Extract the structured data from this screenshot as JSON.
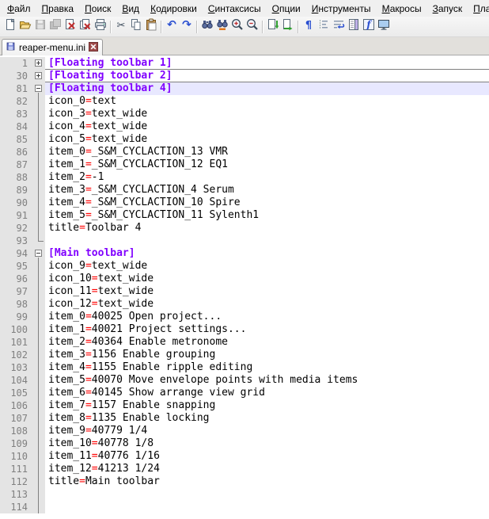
{
  "menu": {
    "items": [
      {
        "label": "Файл",
        "underline": 0
      },
      {
        "label": "Правка",
        "underline": 0
      },
      {
        "label": "Поиск",
        "underline": 0
      },
      {
        "label": "Вид",
        "underline": 0
      },
      {
        "label": "Кодировки",
        "underline": 0
      },
      {
        "label": "Синтаксисы",
        "underline": 0
      },
      {
        "label": "Опции",
        "underline": 0
      },
      {
        "label": "Инструменты",
        "underline": 0
      },
      {
        "label": "Макросы",
        "underline": 0
      },
      {
        "label": "Запуск",
        "underline": 0
      },
      {
        "label": "Пла",
        "underline": 0
      }
    ]
  },
  "toolbar": {
    "buttons": [
      {
        "icon": "new-file"
      },
      {
        "icon": "open-folder"
      },
      {
        "icon": "save",
        "disabled": true
      },
      {
        "icon": "save-all",
        "disabled": true
      },
      {
        "icon": "close"
      },
      {
        "icon": "close-all"
      },
      {
        "icon": "print"
      },
      {
        "icon": "separator"
      },
      {
        "icon": "cut"
      },
      {
        "icon": "copy"
      },
      {
        "icon": "paste"
      },
      {
        "icon": "separator"
      },
      {
        "icon": "undo"
      },
      {
        "icon": "redo"
      },
      {
        "icon": "separator"
      },
      {
        "icon": "find"
      },
      {
        "icon": "replace"
      },
      {
        "icon": "zoom-in"
      },
      {
        "icon": "zoom-out"
      },
      {
        "icon": "separator"
      },
      {
        "icon": "sync-scroll-v"
      },
      {
        "icon": "sync-scroll-h"
      },
      {
        "icon": "separator"
      },
      {
        "icon": "show-symbols"
      },
      {
        "icon": "indent-guide"
      },
      {
        "icon": "word-wrap"
      },
      {
        "icon": "doc-map"
      },
      {
        "icon": "function-list"
      },
      {
        "icon": "monitor"
      }
    ]
  },
  "tabbar": {
    "tabs": [
      {
        "label": "reaper-menu.ini",
        "active": true
      }
    ]
  },
  "editor": {
    "colors": {
      "section": "#8000FF",
      "assignment": "#FF0000",
      "text": "#000000",
      "current_line_bg": "#E8E8FF",
      "line_number": "#808080",
      "margin_bg": "#E4E4E4",
      "background": "#FFFFFF",
      "fold_mark": "#808080"
    },
    "lines": [
      {
        "n": 1,
        "fold": "plus",
        "type": "section",
        "text": "[Floating toolbar 1]",
        "collapsed": true
      },
      {
        "n": 30,
        "fold": "plus",
        "type": "section",
        "text": "[Floating toolbar 2]",
        "collapsed": true
      },
      {
        "n": 81,
        "fold": "minus",
        "type": "section",
        "text": "[Floating toolbar 4]",
        "current": true
      },
      {
        "n": 82,
        "fold": "line",
        "type": "kv",
        "key": "icon_0",
        "value": "text"
      },
      {
        "n": 83,
        "fold": "line",
        "type": "kv",
        "key": "icon_3",
        "value": "text_wide"
      },
      {
        "n": 84,
        "fold": "line",
        "type": "kv",
        "key": "icon_4",
        "value": "text_wide"
      },
      {
        "n": 85,
        "fold": "line",
        "type": "kv",
        "key": "icon_5",
        "value": "text_wide"
      },
      {
        "n": 86,
        "fold": "line",
        "type": "kv",
        "key": "item_0",
        "value": "_S&M_CYCLACTION_13 VMR"
      },
      {
        "n": 87,
        "fold": "line",
        "type": "kv",
        "key": "item_1",
        "value": "_S&M_CYCLACTION_12 EQ1"
      },
      {
        "n": 88,
        "fold": "line",
        "type": "kv",
        "key": "item_2",
        "value": "-1"
      },
      {
        "n": 89,
        "fold": "line",
        "type": "kv",
        "key": "item_3",
        "value": "_S&M_CYCLACTION_4 Serum"
      },
      {
        "n": 90,
        "fold": "line",
        "type": "kv",
        "key": "item_4",
        "value": "_S&M_CYCLACTION_10 Spire"
      },
      {
        "n": 91,
        "fold": "line",
        "type": "kv",
        "key": "item_5",
        "value": "_S&M_CYCLACTION_11 Sylenth1"
      },
      {
        "n": 92,
        "fold": "line",
        "type": "kv",
        "key": "title",
        "value": "Toolbar 4"
      },
      {
        "n": 93,
        "fold": "corner",
        "type": "empty"
      },
      {
        "n": 94,
        "fold": "minus",
        "type": "section",
        "text": "[Main toolbar]"
      },
      {
        "n": 95,
        "fold": "line",
        "type": "kv",
        "key": "icon_9",
        "value": "text_wide"
      },
      {
        "n": 96,
        "fold": "line",
        "type": "kv",
        "key": "icon_10",
        "value": "text_wide"
      },
      {
        "n": 97,
        "fold": "line",
        "type": "kv",
        "key": "icon_11",
        "value": "text_wide"
      },
      {
        "n": 98,
        "fold": "line",
        "type": "kv",
        "key": "icon_12",
        "value": "text_wide"
      },
      {
        "n": 99,
        "fold": "line",
        "type": "kv",
        "key": "item_0",
        "value": "40025 Open project..."
      },
      {
        "n": 100,
        "fold": "line",
        "type": "kv",
        "key": "item_1",
        "value": "40021 Project settings..."
      },
      {
        "n": 101,
        "fold": "line",
        "type": "kv",
        "key": "item_2",
        "value": "40364 Enable metronome"
      },
      {
        "n": 102,
        "fold": "line",
        "type": "kv",
        "key": "item_3",
        "value": "1156 Enable grouping"
      },
      {
        "n": 103,
        "fold": "line",
        "type": "kv",
        "key": "item_4",
        "value": "1155 Enable ripple editing"
      },
      {
        "n": 104,
        "fold": "line",
        "type": "kv",
        "key": "item_5",
        "value": "40070 Move envelope points with media items"
      },
      {
        "n": 105,
        "fold": "line",
        "type": "kv",
        "key": "item_6",
        "value": "40145 Show arrange view grid"
      },
      {
        "n": 106,
        "fold": "line",
        "type": "kv",
        "key": "item_7",
        "value": "1157 Enable snapping"
      },
      {
        "n": 107,
        "fold": "line",
        "type": "kv",
        "key": "item_8",
        "value": "1135 Enable locking"
      },
      {
        "n": 108,
        "fold": "line",
        "type": "kv",
        "key": "item_9",
        "value": "40779 1/4"
      },
      {
        "n": 109,
        "fold": "line",
        "type": "kv",
        "key": "item_10",
        "value": "40778 1/8"
      },
      {
        "n": 110,
        "fold": "line",
        "type": "kv",
        "key": "item_11",
        "value": "40776 1/16"
      },
      {
        "n": 111,
        "fold": "line",
        "type": "kv",
        "key": "item_12",
        "value": "41213 1/24"
      },
      {
        "n": 112,
        "fold": "line",
        "type": "kv",
        "key": "title",
        "value": "Main toolbar"
      },
      {
        "n": 113,
        "fold": "line",
        "type": "empty"
      },
      {
        "n": 114,
        "fold": "line",
        "type": "empty"
      }
    ]
  }
}
